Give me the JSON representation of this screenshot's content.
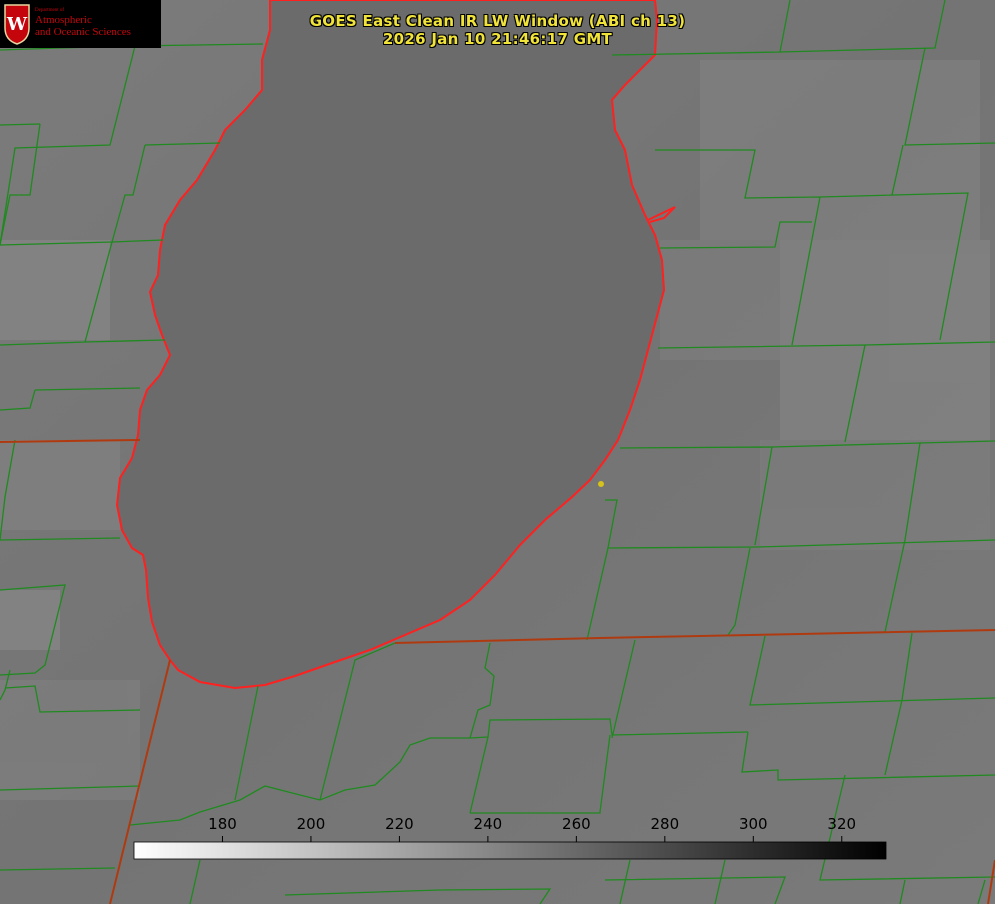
{
  "header": {
    "title": "GOES East Clean IR LW Window (ABI ch 13)",
    "timestamp": "2026 Jan 10 21:46:17 GMT"
  },
  "logo": {
    "department_small": "Department of",
    "line1": "Atmospheric",
    "line2": "and Oceanic Sciences",
    "seal_letter": "W"
  },
  "colorbar": {
    "min": 160,
    "max": 330,
    "ticks": [
      180,
      200,
      220,
      240,
      260,
      280,
      300,
      320
    ],
    "gradient": [
      "#ffffff",
      "#000000"
    ]
  },
  "colors": {
    "county_lines": "#1f8a1f",
    "state_lines": "#b03a10",
    "shoreline": "#ff2020",
    "title_text": "#f0e33a",
    "marker": "#d6c21a"
  },
  "marker": {
    "icon": "station-dot-icon"
  }
}
